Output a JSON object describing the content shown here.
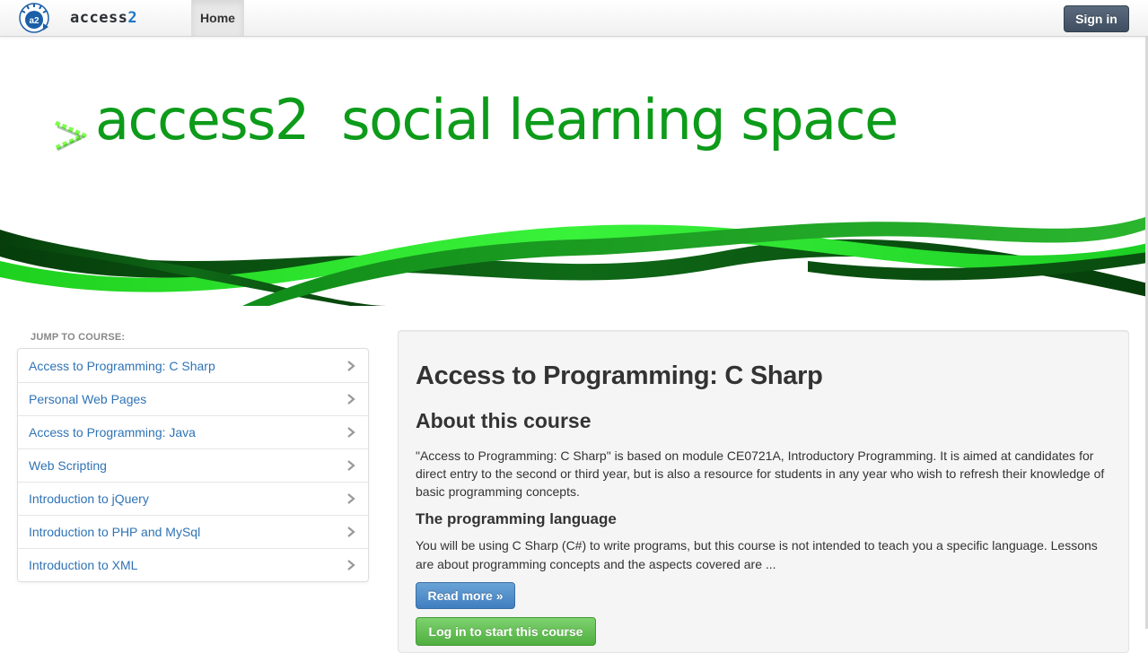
{
  "navbar": {
    "brand_text": "access",
    "brand_suffix": "2",
    "logo_text": "a2",
    "home_label": "Home",
    "signin_label": "Sign in"
  },
  "hero": {
    "title": "access2  social learning space",
    "arrow_glyph": ">"
  },
  "sidebar": {
    "heading": "JUMP TO COURSE:",
    "items": [
      {
        "label": "Access to Programming: C Sharp"
      },
      {
        "label": "Personal Web Pages"
      },
      {
        "label": "Access to Programming: Java"
      },
      {
        "label": "Web Scripting"
      },
      {
        "label": "Introduction to jQuery"
      },
      {
        "label": "Introduction to PHP and MySql"
      },
      {
        "label": "Introduction to XML"
      }
    ]
  },
  "course": {
    "title": "Access to Programming: C Sharp",
    "about_heading": "About this course",
    "about_text": "\"Access to Programming: C Sharp\" is based on module CE0721A, Introductory Programming. It is aimed at candidates for direct entry to the second or third year, but is also a resource for students in any year who wish to refresh their knowledge of basic programming concepts.",
    "language_heading": "The programming language",
    "language_text": "You will be using C Sharp (C#) to write programs, but this course is not intended to teach you a specific language. Lessons are about programming concepts and the aspects covered are ...",
    "read_more_label": "Read more »",
    "start_label": "Log in to start this course"
  },
  "colors": {
    "brand_green": "#0d9b1a",
    "link_blue": "#2f73b5",
    "signin_bg": "#4a5a6c",
    "readmore_bg": "#4f8ccb",
    "start_bg": "#62c152"
  }
}
